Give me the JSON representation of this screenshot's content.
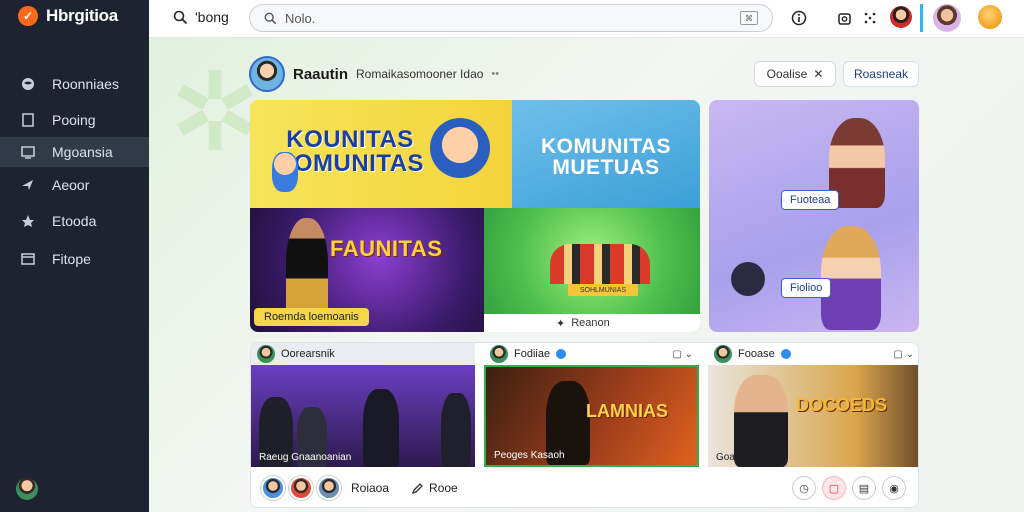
{
  "app": {
    "name": "Hbrgitioa",
    "logo_glyph": "✓",
    "accent": "#ff6a1a"
  },
  "sidebar": {
    "items": [
      {
        "label": "Roonniaes",
        "icon": "globe-icon",
        "active": false
      },
      {
        "label": "Pooing",
        "icon": "document-icon",
        "active": false
      },
      {
        "label": "Mgoansia",
        "icon": "monitor-icon",
        "active": true
      },
      {
        "label": "Aeoor",
        "icon": "compass-icon",
        "active": false
      },
      {
        "label": "Etooda",
        "icon": "star-icon",
        "active": false
      },
      {
        "label": "Fitope",
        "icon": "calendar-icon",
        "active": false
      }
    ]
  },
  "topbar": {
    "search_label": "'bong",
    "search_value": "Nolo.",
    "icons": [
      "info-icon",
      "camera-icon",
      "grid-icon"
    ]
  },
  "header": {
    "title": "Raautin",
    "subtitle": "Romaikasomooner Idao",
    "dots": "••",
    "outline_button": "Ooalise",
    "primary_button": "Roasneak"
  },
  "hero": {
    "tile_a_text": "KOUNITAS\nHOMUNITAS",
    "tile_b_text": "KOMUNITAS\nMUETUAS",
    "tile_c_text": "FAUNITAS",
    "tile_c_label": "Roemda loemoanis",
    "tile_d_banner": "SOHLMUNIAS",
    "tile_d_footer": "Reanon",
    "tile_e_tag_1": "Fuoteaa",
    "tile_e_tag_2": "Fiolioo"
  },
  "videos": [
    {
      "channel": "Oorearsnik",
      "caption": "Raeug Gnaanoanian",
      "verified": false
    },
    {
      "channel": "Fodiiae",
      "caption": "Peoges Kasaoh",
      "title": "LAMNIAS",
      "verified": true
    },
    {
      "channel": "Fooase",
      "caption": "Goaad Maaicaa",
      "title": "DOCOEDS",
      "verified": true
    }
  ],
  "footer": {
    "name": "Roiaoa",
    "link": "Rooe"
  }
}
